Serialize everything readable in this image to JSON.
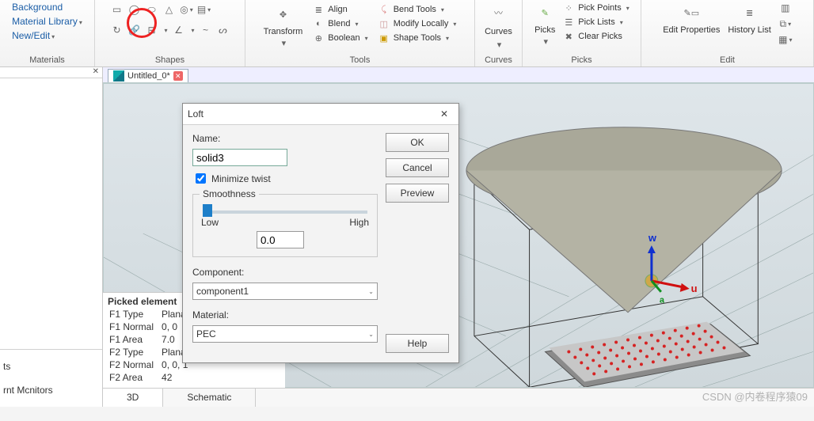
{
  "ribbon": {
    "materials": {
      "bg": "Background",
      "lib": "Material Library",
      "newedit": "New/Edit",
      "label": "Materials"
    },
    "shapes": {
      "label": "Shapes"
    },
    "tools": {
      "transform": "Transform",
      "align": "Align",
      "blend": "Blend",
      "boolean": "Boolean",
      "bend": "Bend Tools",
      "modify": "Modify Locally",
      "shape": "Shape Tools",
      "label": "Tools"
    },
    "curves": {
      "btn": "Curves",
      "label": "Curves"
    },
    "picks": {
      "btn": "Picks",
      "pp": "Pick Points",
      "pl": "Pick Lists",
      "cp": "Clear Picks",
      "label": "Picks"
    },
    "edit": {
      "ep": "Edit Properties",
      "hl": "History List",
      "label": "Edit"
    }
  },
  "tab": {
    "title": "Untitled_0*"
  },
  "left": {
    "item1": "ts",
    "item2": "rnt Mcnitors"
  },
  "picked": {
    "header": "Picked element",
    "rows": [
      [
        "F1 Type",
        "Planar"
      ],
      [
        "F1 Normal",
        "0, 0"
      ],
      [
        "F1 Area",
        "7.0"
      ],
      [
        "F2 Type",
        "Planar"
      ],
      [
        "F2 Normal",
        "0, 0, 1"
      ],
      [
        "F2 Area",
        "42"
      ]
    ]
  },
  "viewtabs": {
    "a": "3D",
    "b": "Schematic"
  },
  "dialog": {
    "title": "Loft",
    "name_label": "Name:",
    "name_value": "solid3",
    "min_twist": "Minimize twist",
    "smooth_label": "Smoothness",
    "low": "Low",
    "high": "High",
    "smooth_value": "0.0",
    "comp_label": "Component:",
    "comp_value": "component1",
    "mat_label": "Material:",
    "mat_value": "PEC",
    "ok": "OK",
    "cancel": "Cancel",
    "preview": "Preview",
    "help": "Help"
  },
  "axes": {
    "u": "u",
    "w": "w",
    "a": "a"
  },
  "watermark": "CSDN @内卷程序猿09"
}
